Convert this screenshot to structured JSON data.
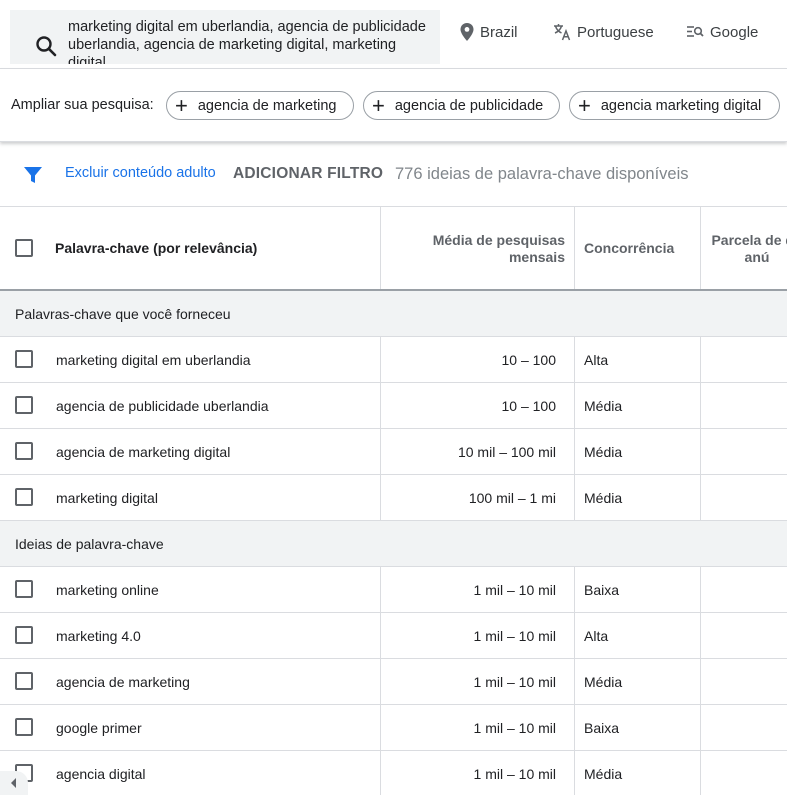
{
  "search": {
    "query": "marketing digital em uberlandia, agencia de publicidade uberlandia, agencia de marketing digital, marketing digital"
  },
  "targeting": {
    "location": "Brazil",
    "language": "Portuguese",
    "network": "Google"
  },
  "broaden": {
    "label": "Ampliar sua pesquisa:",
    "chips": [
      "agencia de marketing",
      "agencia de publicidade",
      "agencia marketing digital"
    ]
  },
  "filters": {
    "exclude_adult": "Excluir conteúdo adulto",
    "add_filter": "ADICIONAR FILTRO",
    "ideas_available": "776 ideias de palavra-chave disponíveis"
  },
  "table": {
    "headers": {
      "keyword": "Palavra-chave (por relevância)",
      "avg_searches": "Média de pesquisas mensais",
      "competition": "Concorrência",
      "impression_share": "Parcela de do anú"
    },
    "groups": [
      {
        "title": "Palavras-chave que você forneceu",
        "rows": [
          {
            "keyword": "marketing digital em uberlandia",
            "avg": "10 – 100",
            "competition": "Alta"
          },
          {
            "keyword": "agencia de publicidade uberlandia",
            "avg": "10 – 100",
            "competition": "Média"
          },
          {
            "keyword": "agencia de marketing digital",
            "avg": "10 mil – 100 mil",
            "competition": "Média"
          },
          {
            "keyword": "marketing digital",
            "avg": "100 mil – 1 mi",
            "competition": "Média"
          }
        ]
      },
      {
        "title": "Ideias de palavra-chave",
        "rows": [
          {
            "keyword": "marketing online",
            "avg": "1 mil – 10 mil",
            "competition": "Baixa"
          },
          {
            "keyword": "marketing 4.0",
            "avg": "1 mil – 10 mil",
            "competition": "Alta"
          },
          {
            "keyword": "agencia de marketing",
            "avg": "1 mil – 10 mil",
            "competition": "Média"
          },
          {
            "keyword": "google primer",
            "avg": "1 mil – 10 mil",
            "competition": "Baixa"
          },
          {
            "keyword": "agencia digital",
            "avg": "1 mil – 10 mil",
            "competition": "Média"
          }
        ]
      }
    ]
  },
  "colors": {
    "accent": "#1a73e8",
    "group_bg": "#f1f3f4",
    "search_bg": "#f1f3f4",
    "divider": "#dadce0"
  },
  "icons": {
    "search": "search-icon",
    "location": "location-pin-icon",
    "language": "translate-icon",
    "network": "search-network-icon",
    "filter": "filter-funnel-icon",
    "add": "plus-icon",
    "scroll": "chevron-left-icon"
  }
}
